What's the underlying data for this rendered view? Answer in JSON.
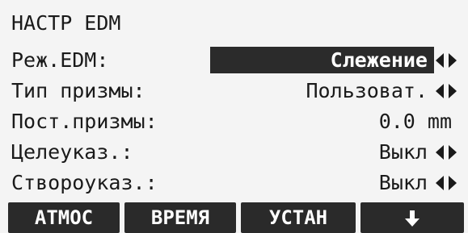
{
  "screen": {
    "title": "НАСТР EDM"
  },
  "rows": [
    {
      "label": "Реж.EDM:",
      "value": "Слежение",
      "has_arrows": true,
      "selected": true
    },
    {
      "label": "Тип призмы:",
      "value": "Пользоват.",
      "has_arrows": true,
      "selected": false
    },
    {
      "label": "Пост.призмы:",
      "value": "0.0 mm",
      "has_arrows": false,
      "selected": false
    },
    {
      "label": "Целеуказ.:",
      "value": "Выкл",
      "has_arrows": true,
      "selected": false
    },
    {
      "label": "Створоуказ.:",
      "value": "Выкл",
      "has_arrows": true,
      "selected": false
    }
  ],
  "softkeys": {
    "f1": "ATMOC",
    "f2": "ВРЕМЯ",
    "f3": "УСТАН",
    "f4_icon": "arrow-down-icon"
  },
  "colors": {
    "screen_bg": "#f4f4f4",
    "text": "#1a1a1a",
    "highlight_bg": "#2b2b2b",
    "softkey_bg": "#2a2a2a",
    "softkey_text": "#ffffff"
  }
}
